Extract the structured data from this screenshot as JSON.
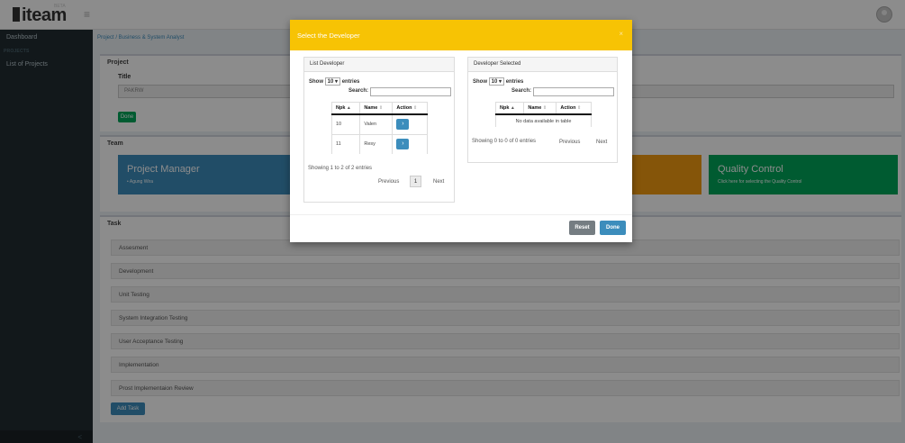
{
  "header": {
    "logo_text": "iteam",
    "logo_sup": "BETA"
  },
  "sidebar": {
    "dashboard": "Dashboard",
    "section": "PROJECTS",
    "list_projects": "List of Projects",
    "toggle": "<"
  },
  "breadcrumb": "Project  /  Business & System Analyst",
  "project": {
    "box_title": "Project",
    "title_label": "Title",
    "title_value": "PAKRW",
    "done_label": "Done"
  },
  "team": {
    "box_title": "Team",
    "cards": [
      {
        "title": "Project Manager",
        "subtitle": "Agung Wira",
        "color": "#3c8dbc"
      },
      {
        "title": "",
        "subtitle": "",
        "color": "#f39c12"
      },
      {
        "title": "Quality Control",
        "subtitle": "Click here for selecting the Quality Control",
        "color": "#00a65a"
      }
    ]
  },
  "task": {
    "box_title": "Task",
    "items": [
      "Assesment",
      "Development",
      "Unit Testing",
      "System Integration Testing",
      "User Acceptance Testing",
      "Implementation",
      "Prost Implementaion Review"
    ],
    "add_label": "Add Task"
  },
  "modal": {
    "title": "Select the Developer",
    "close": "×",
    "list": {
      "heading": "List Developer",
      "show": "Show",
      "length": "10",
      "entries": "entries",
      "search": "Search:",
      "columns": [
        "Npk",
        "Name",
        "Action"
      ],
      "rows": [
        {
          "npk": "10",
          "name": "Valen",
          "action": "›"
        },
        {
          "npk": "11",
          "name": "Resy",
          "action": "›"
        }
      ],
      "info": "Showing 1 to 2 of 2 entries",
      "previous": "Previous",
      "page": "1",
      "next": "Next"
    },
    "selected": {
      "heading": "Developer Selected",
      "show": "Show",
      "length": "10",
      "entries": "entries",
      "search": "Search:",
      "columns": [
        "Npk",
        "Name",
        "Action"
      ],
      "empty": "No data available in table",
      "info": "Showing 0 to 0 of 0 entries",
      "previous": "Previous",
      "next": "Next"
    },
    "reset_label": "Reset",
    "done_label": "Done"
  },
  "colors": {
    "modal_header": "#f7c304",
    "primary": "#3c8dbc",
    "success": "#00a65a",
    "sidebar": "#222d32"
  }
}
